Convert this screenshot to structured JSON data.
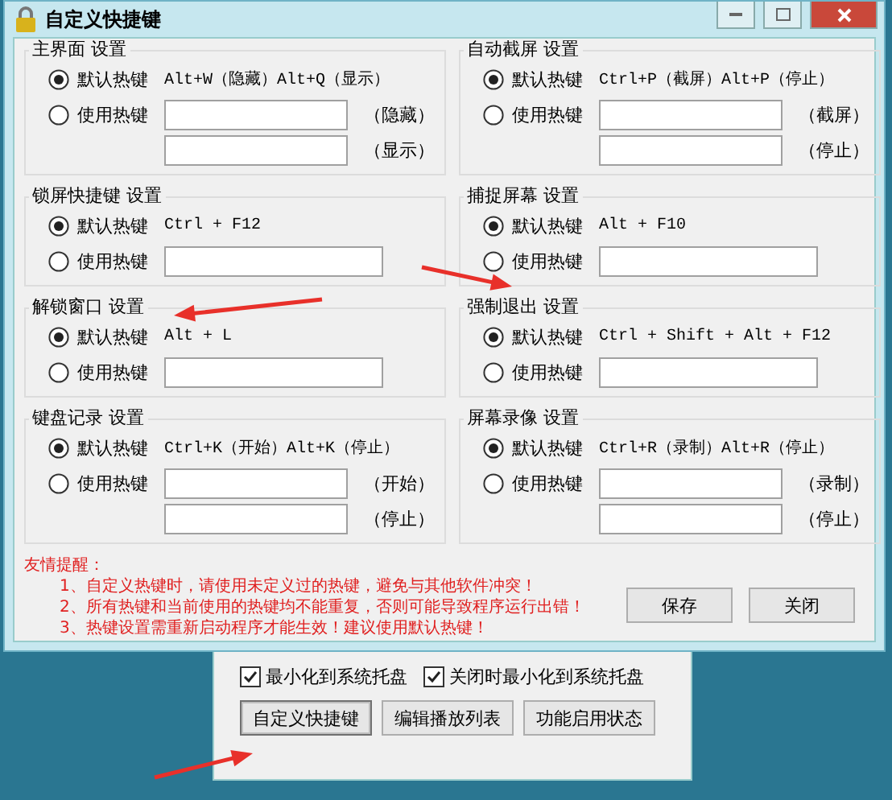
{
  "window": {
    "title": "自定义快捷键"
  },
  "groups": [
    {
      "title": "主界面 设置",
      "kind": "dual",
      "options": [
        {
          "label": "默认热键",
          "selected": true,
          "hotkey": "Alt+W（隐藏）Alt+Q（显示）"
        },
        {
          "label": "使用热键",
          "selected": false
        }
      ],
      "suffixes": [
        "（隐藏）",
        "（显示）"
      ]
    },
    {
      "title": "自动截屏 设置",
      "kind": "dual",
      "options": [
        {
          "label": "默认热键",
          "selected": true,
          "hotkey": "Ctrl+P（截屏）Alt+P（停止）"
        },
        {
          "label": "使用热键",
          "selected": false
        }
      ],
      "suffixes": [
        "（截屏）",
        "（停止）"
      ]
    },
    {
      "title": "锁屏快捷键 设置",
      "kind": "single",
      "options": [
        {
          "label": "默认热键",
          "selected": true,
          "hotkey": "Ctrl + F12"
        },
        {
          "label": "使用热键",
          "selected": false
        }
      ]
    },
    {
      "title": "捕捉屏幕 设置",
      "kind": "single",
      "options": [
        {
          "label": "默认热键",
          "selected": true,
          "hotkey": "Alt + F10"
        },
        {
          "label": "使用热键",
          "selected": false
        }
      ]
    },
    {
      "title": "解锁窗口 设置",
      "kind": "single",
      "options": [
        {
          "label": "默认热键",
          "selected": true,
          "hotkey": "Alt + L"
        },
        {
          "label": "使用热键",
          "selected": false
        }
      ]
    },
    {
      "title": "强制退出 设置",
      "kind": "single",
      "options": [
        {
          "label": "默认热键",
          "selected": true,
          "hotkey": "Ctrl + Shift + Alt + F12"
        },
        {
          "label": "使用热键",
          "selected": false
        }
      ]
    },
    {
      "title": "键盘记录 设置",
      "kind": "dual",
      "options": [
        {
          "label": "默认热键",
          "selected": true,
          "hotkey": "Ctrl+K（开始）Alt+K（停止）"
        },
        {
          "label": "使用热键",
          "selected": false
        }
      ],
      "suffixes": [
        "（开始）",
        "（停止）"
      ]
    },
    {
      "title": "屏幕录像 设置",
      "kind": "dual",
      "options": [
        {
          "label": "默认热键",
          "selected": true,
          "hotkey": "Ctrl+R（录制）Alt+R（停止）"
        },
        {
          "label": "使用热键",
          "selected": false
        }
      ],
      "suffixes": [
        "（录制）",
        "（停止）"
      ]
    }
  ],
  "notes": {
    "heading": "友情提醒：",
    "items": [
      "1、自定义热键时，请使用未定义过的热键，避免与其他软件冲突！",
      "2、所有热键和当前使用的热键均不能重复，否则可能导致程序运行出错！",
      "3、热键设置需重新启动程序才能生效！建议使用默认热键！"
    ]
  },
  "buttons": [
    "保存",
    "关闭"
  ],
  "back_panel": {
    "checkboxes": [
      {
        "label": "最小化到系统托盘",
        "checked": true
      },
      {
        "label": "关闭时最小化到系统托盘",
        "checked": true
      }
    ],
    "buttons": [
      {
        "label": "自定义快捷键",
        "focused": true
      },
      {
        "label": "编辑播放列表",
        "focused": false
      },
      {
        "label": "功能启用状态",
        "focused": false
      }
    ]
  }
}
